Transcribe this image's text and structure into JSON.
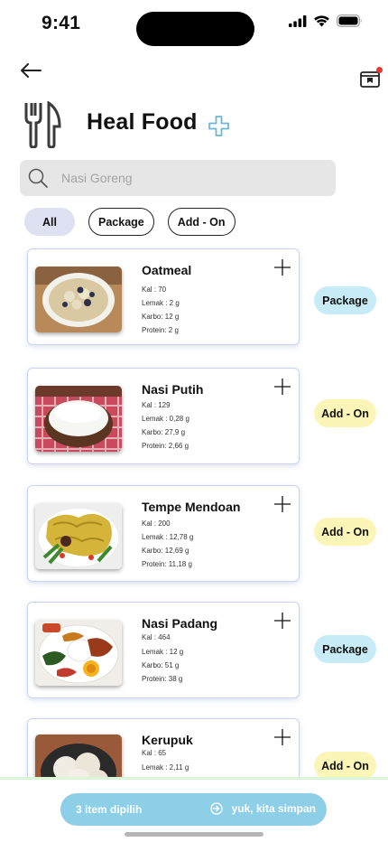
{
  "status_bar": {
    "time": "9:41"
  },
  "header": {
    "title": "Heal Food"
  },
  "search": {
    "placeholder": "Nasi Goreng"
  },
  "filters": [
    {
      "label": "All",
      "active": true
    },
    {
      "label": "Package",
      "active": false
    },
    {
      "label": "Add - On",
      "active": false
    }
  ],
  "foods": [
    {
      "name": "Oatmeal",
      "kal": "Kal : 70",
      "lemak": "Lemak : 2 g",
      "karbo": "Karbo: 12 g",
      "protein": "Protein: 2 g",
      "tag": "Package"
    },
    {
      "name": "Nasi Putih",
      "kal": "Kal : 129",
      "lemak": "Lemak : 0,28 g",
      "karbo": "Karbo: 27,9 g",
      "protein": "Protein: 2,66 g",
      "tag": "Add - On"
    },
    {
      "name": "Tempe Mendoan",
      "kal": "Kal : 200",
      "lemak": "Lemak : 12,78 g",
      "karbo": "Karbo: 12,69 g",
      "protein": "Protein: 11,18 g",
      "tag": "Add - On"
    },
    {
      "name": "Nasi Padang",
      "kal": "Kal : 464",
      "lemak": "Lemak : 12 g",
      "karbo": "Karbo: 51 g",
      "protein": "Protein: 38 g",
      "tag": "Package"
    },
    {
      "name": "Kerupuk",
      "kal": "Kal : 65",
      "lemak": "Lemak : 2,11 g",
      "karbo": "",
      "protein": "",
      "tag": "Add - On"
    }
  ],
  "footer": {
    "count_label": "3 item dipilih",
    "action_label": "yuk, kita simpan"
  },
  "colors": {
    "package_tag": "#c7ecf7",
    "addon_tag": "#fbf5b8",
    "cta": "#8ecfe8",
    "card_border": "#c8d4f7",
    "filter_active": "#dde1f2"
  }
}
